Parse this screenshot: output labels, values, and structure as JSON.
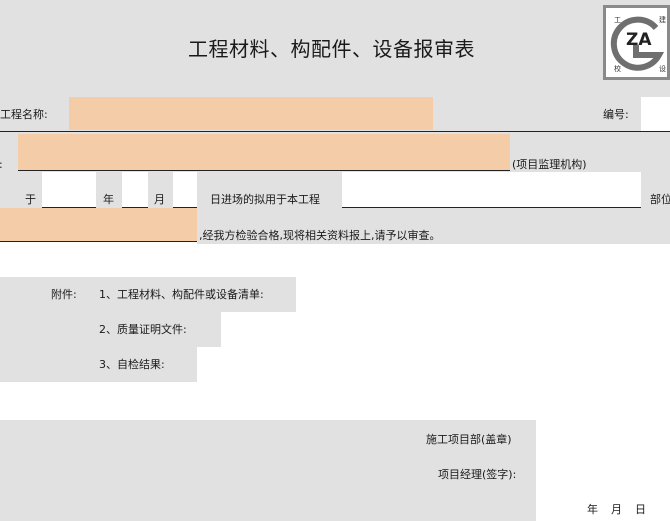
{
  "form": {
    "title": "工程材料、构配件、设备报审表",
    "project_name_label": "工程名称:",
    "number_label": "编号:",
    "to_label": "致:",
    "supervisor_org": "(项目监理机构)",
    "at_label": "于",
    "year_label": "年",
    "month_label": "月",
    "entry_text": "日进场的拟用于本工程",
    "location_label": "部位",
    "inspection_text": ",经我方检验合格,现将相关资料报上,请予以审查。",
    "attachment_label": "附件:",
    "attachments": [
      "1、工程材料、构配件或设备清单:",
      "2、质量证明文件:",
      "3、自检结果:"
    ],
    "construction_dept": "施工项目部(盖章)",
    "project_manager": "项目经理(签字):",
    "date_year": "年",
    "date_month": "月",
    "date_day": "日"
  },
  "logo": {
    "letters": "ZA",
    "chars": [
      "工",
      "建",
      "校",
      "设"
    ]
  }
}
